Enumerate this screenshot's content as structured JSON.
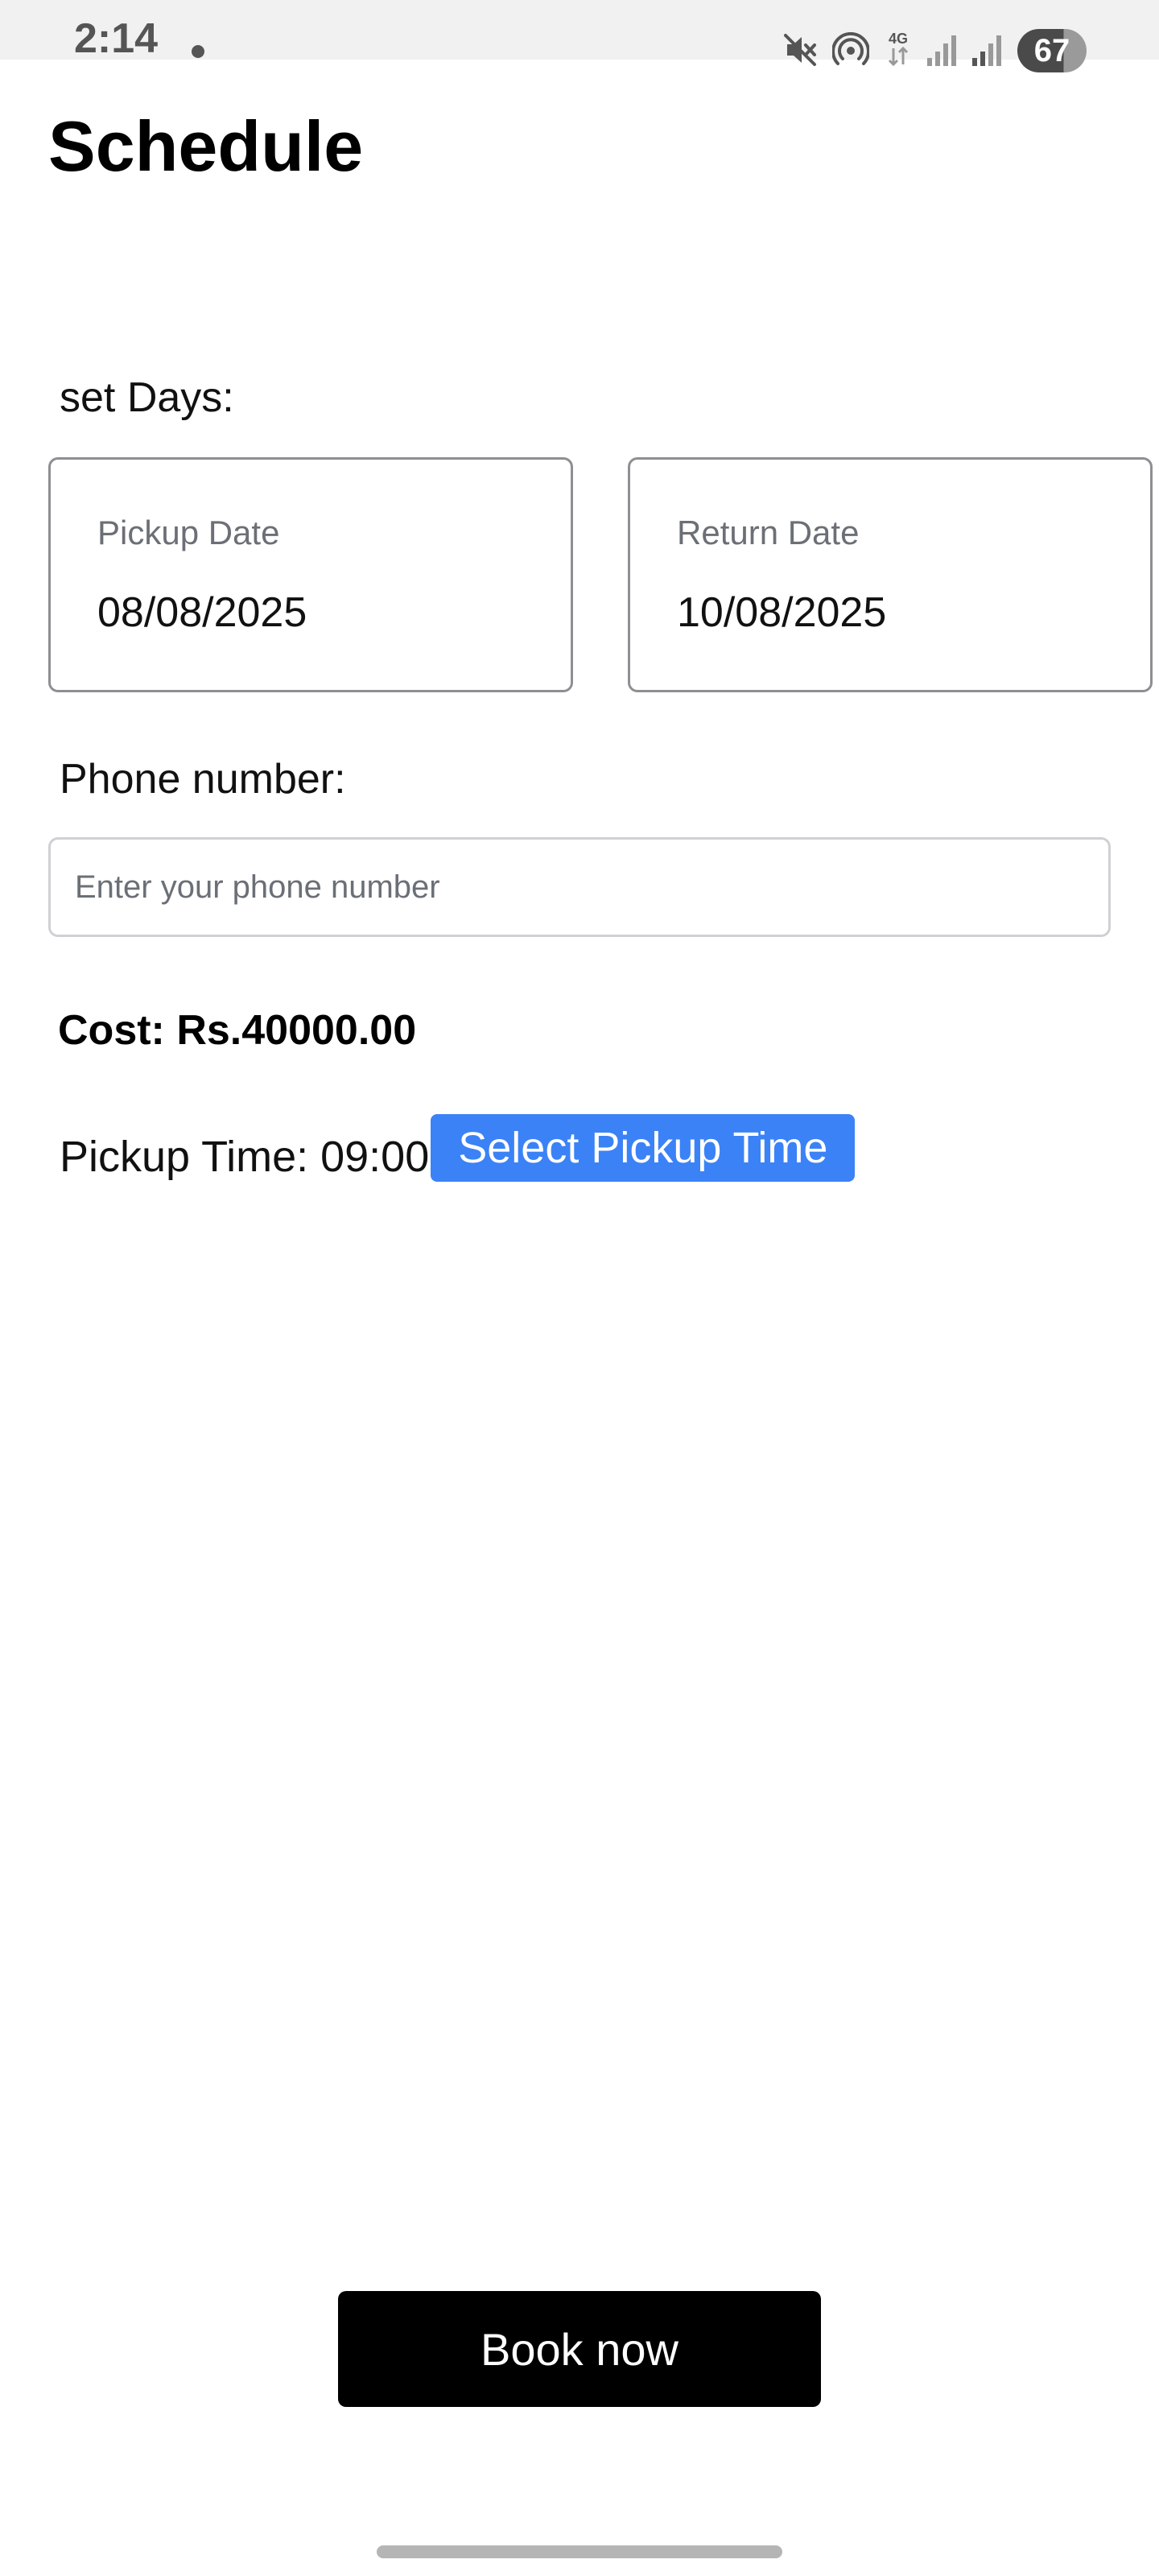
{
  "status_bar": {
    "time": "2:14",
    "network": "4G",
    "battery": "67",
    "icons": [
      "notification-dot-icon",
      "mute-icon",
      "hotspot-icon",
      "network-4g-icon",
      "signal-icon",
      "signal-icon",
      "battery-icon"
    ]
  },
  "header": {
    "title": "Schedule"
  },
  "days": {
    "label": "set Days:",
    "pickup": {
      "label": "Pickup Date",
      "value": "08/08/2025"
    },
    "return": {
      "label": "Return Date",
      "value": "10/08/2025"
    }
  },
  "phone": {
    "label": "Phone number:",
    "placeholder": "Enter your phone number",
    "value": ""
  },
  "cost": {
    "text": "Cost: Rs.40000.00"
  },
  "pickup_time": {
    "text": "Pickup Time: 09:00",
    "button_label": "Select Pickup Time"
  },
  "footer": {
    "book_label": "Book now"
  },
  "colors": {
    "accent": "#3b82f6",
    "primary_button": "#000000",
    "status_bar_bg": "#f1f1f1"
  }
}
